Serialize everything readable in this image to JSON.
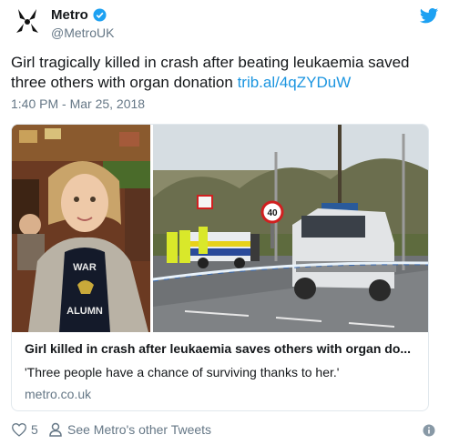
{
  "user": {
    "name": "Metro",
    "handle": "@MetroUK"
  },
  "tweet": {
    "text_before_link": "Girl tragically killed in crash after beating leukaemia saved three others with organ donation ",
    "link": "trib.al/4qZYDuW",
    "timestamp": "1:40 PM - Mar 25, 2018"
  },
  "card": {
    "title": "Girl killed in crash after leukaemia saves others with organ do...",
    "description": "'Three people have a chance of surviving thanks to her.'",
    "domain": "metro.co.uk",
    "photo_text": {
      "line1": "WAR",
      "line2": "ALUMN"
    },
    "road_sign": "40"
  },
  "footer": {
    "likes": "5",
    "see_more": "See Metro's other Tweets"
  },
  "colors": {
    "link": "#1b95e0",
    "muted": "#657786",
    "twitter": "#1da1f2"
  }
}
